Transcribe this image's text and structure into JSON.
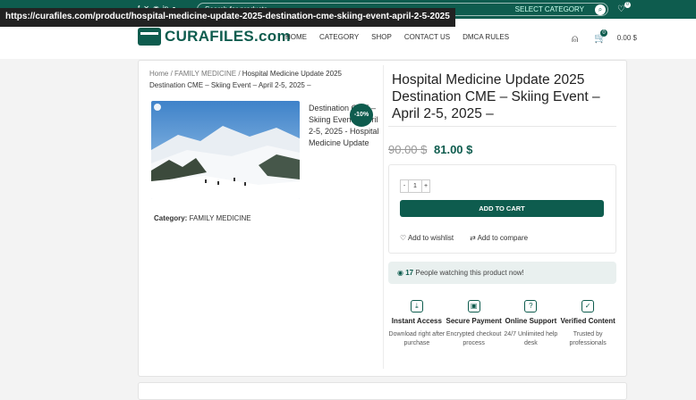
{
  "url_tooltip": "https://curafiles.com/product/hospital-medicine-update-2025-destination-cme-skiing-event-april-2-5-2025",
  "topbar": {
    "search_placeholder": "Search for products",
    "search_category": "SELECT CATEGORY",
    "wishlist_count": "0"
  },
  "header": {
    "logo": "CURAFILES.com",
    "nav": [
      "HOME",
      "CATEGORY",
      "SHOP",
      "CONTACT US",
      "DMCA RULES"
    ],
    "cart_count": "0",
    "cart_total": "0.00 $"
  },
  "breadcrumb": {
    "home": "Home",
    "category": "FAMILY MEDICINE",
    "current": "Hospital Medicine Update 2025 Destination CME – Skiing Event – April 2-5, 2025 –"
  },
  "product": {
    "side_title": "Destination CME – Skiing Event – April 2-5, 2025 - Hospital Medicine Update",
    "discount": "-10%",
    "category_label": "Category:",
    "category_value": "FAMILY MEDICINE",
    "title": "Hospital Medicine Update 2025 Destination CME – Skiing Event – April 2-5, 2025 –",
    "old_price": "90.00 $",
    "new_price": "81.00 $",
    "qty_minus": "-",
    "qty_value": "1",
    "qty_plus": "+",
    "add_to_cart": "ADD TO CART",
    "wishlist": "Add to wishlist",
    "compare": "Add to compare",
    "watch_count": "17",
    "watch_text": "People watching this product now!"
  },
  "features": [
    {
      "title": "Instant Access",
      "desc": "Download right after purchase",
      "icon": "download-icon"
    },
    {
      "title": "Secure Payment",
      "desc": "Encrypted checkout process",
      "icon": "wallet-icon"
    },
    {
      "title": "Online Support",
      "desc": "24/7 Unlimited help desk",
      "icon": "support-icon"
    },
    {
      "title": "Verified Content",
      "desc": "Trusted by professionals",
      "icon": "badge-icon"
    }
  ],
  "colors": {
    "brand": "#0e5c4e",
    "badge_bg": "#e9f0ef"
  }
}
